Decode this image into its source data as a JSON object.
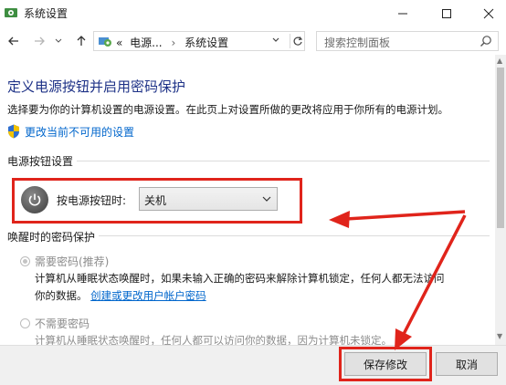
{
  "window": {
    "title": "系统设置"
  },
  "nav": {
    "breadcrumb_root": "«",
    "breadcrumb_parent": "电源...",
    "breadcrumb_sep": "›",
    "breadcrumb_current": "系统设置",
    "search_placeholder": "搜索控制面板"
  },
  "page": {
    "heading": "定义电源按钮并启用密码保护",
    "description": "选择要为你的计算机设置的电源设置。在此页上对设置所做的更改将应用于你所有的电源计划。",
    "change_link": "更改当前不可用的设置"
  },
  "power_buttons": {
    "section_title": "电源按钮设置",
    "label": "按电源按钮时:",
    "selected": "关机"
  },
  "wake_password": {
    "section_title": "唤醒时的密码保护",
    "require_label": "需要密码(推荐)",
    "require_desc_line1": "计算机从睡眠状态唤醒时，如果未输入正确的密码来解除计算机锁定，任何人都无法访问",
    "require_desc_line2_prefix": "你的数据。",
    "require_desc_link": "创建或更改用户帐户密码",
    "no_require_label": "不需要密码",
    "no_require_desc": "计算机从睡眠状态唤醒时，任何人都可以访问你的数据，因为计算机未锁定。"
  },
  "footer": {
    "save": "保存修改",
    "cancel": "取消"
  },
  "colors": {
    "accent_red": "#e0241b",
    "link": "#0066cc",
    "heading": "#1e3287"
  },
  "icons": [
    "app-icon",
    "minimize-icon",
    "maximize-icon",
    "close-icon",
    "back-arrow-icon",
    "forward-arrow-icon",
    "dropdown-icon",
    "up-arrow-icon",
    "control-panel-icon",
    "refresh-icon",
    "search-icon",
    "shield-icon",
    "power-icon"
  ]
}
